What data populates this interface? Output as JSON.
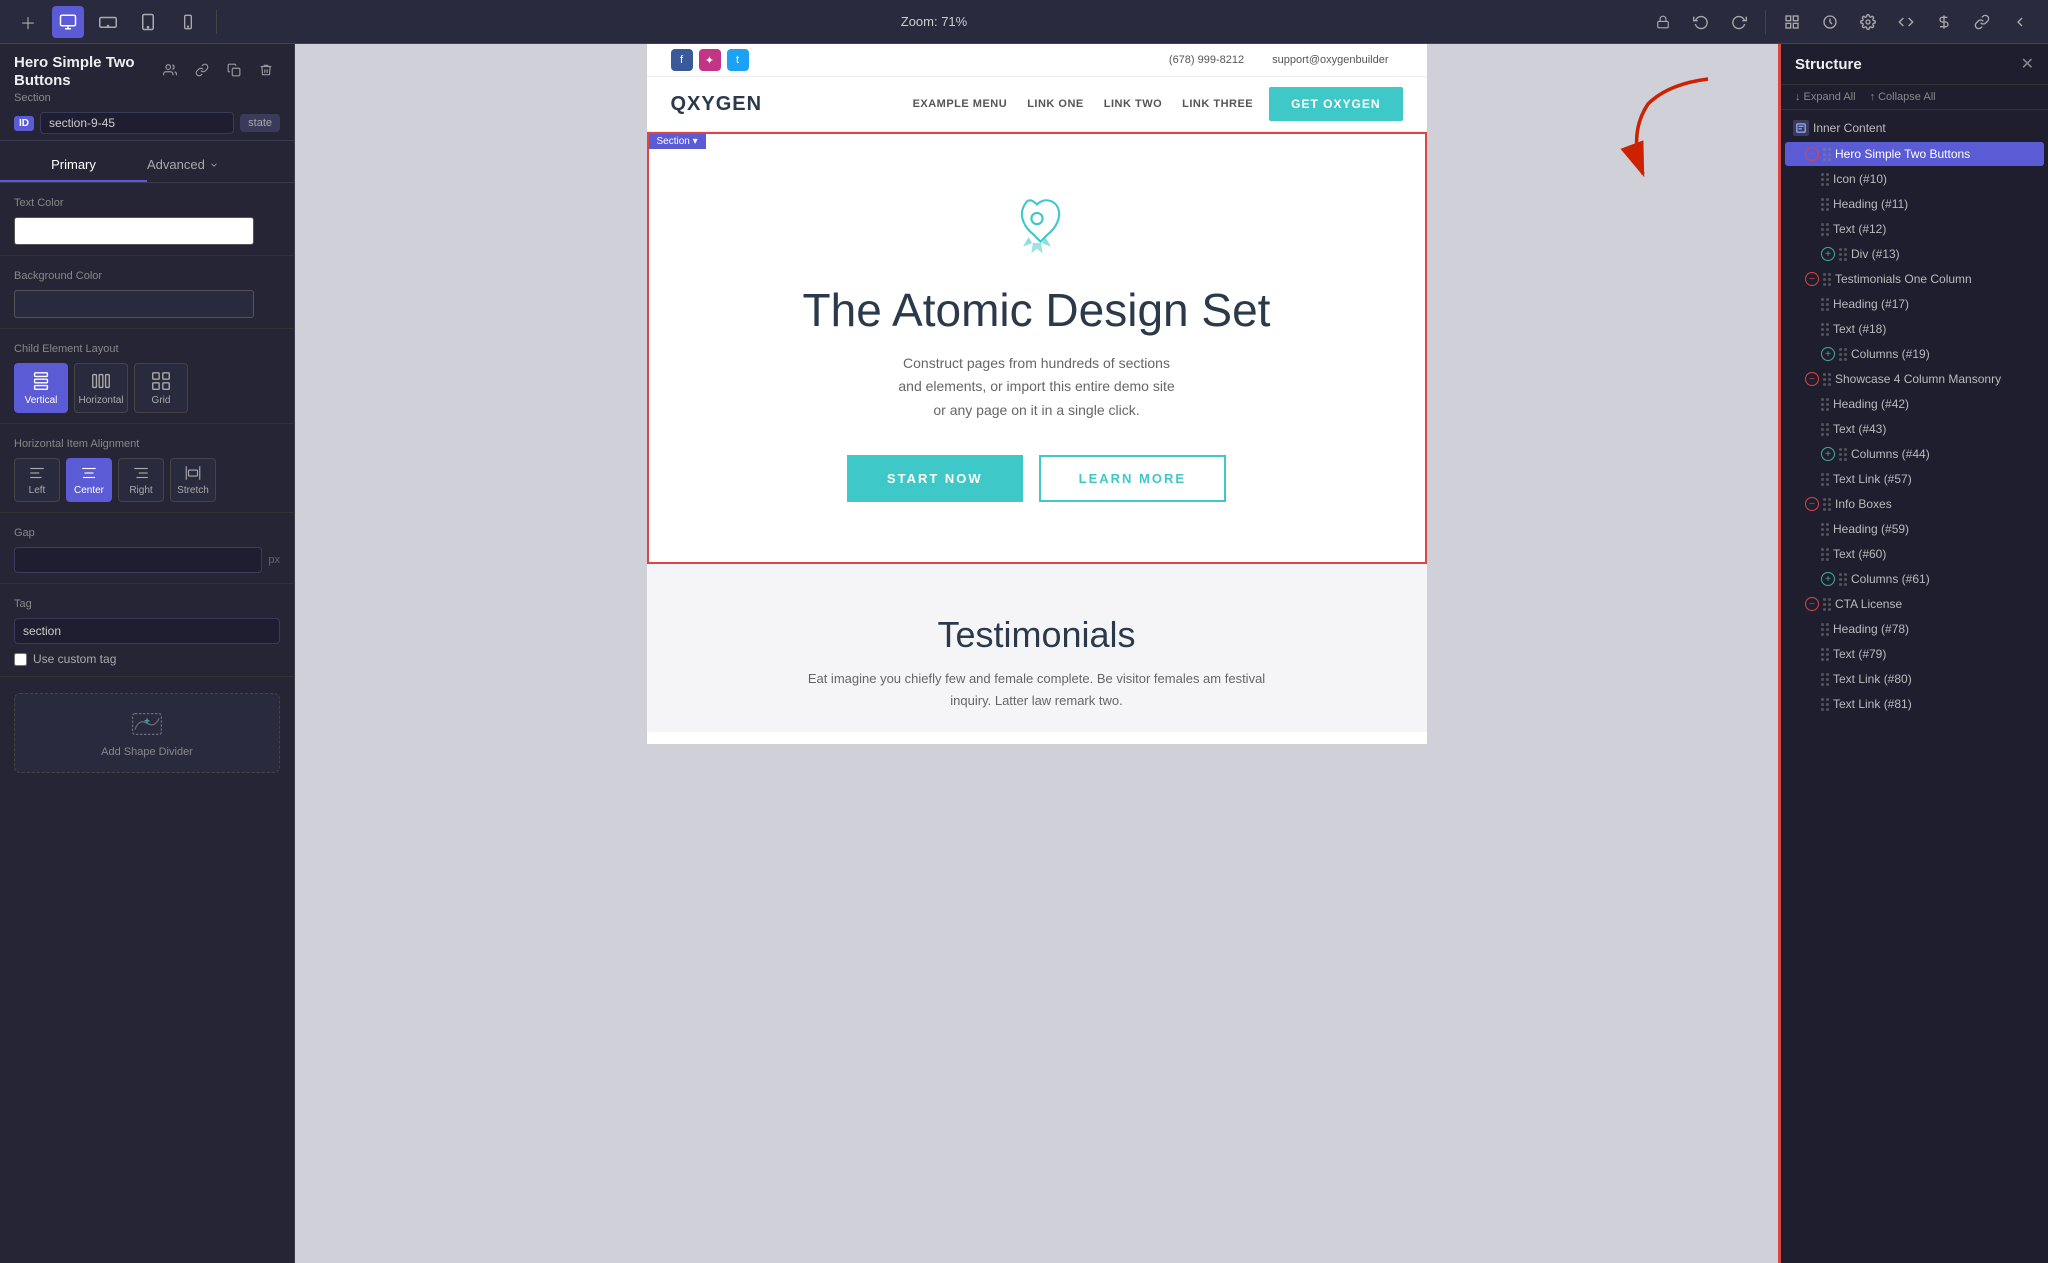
{
  "toolbar": {
    "zoom_label": "Zoom: 71%",
    "icons": [
      "plus",
      "desktop",
      "tablet_landscape",
      "tablet_portrait",
      "mobile"
    ],
    "right_icons": [
      "lock",
      "undo",
      "redo",
      "layout",
      "history",
      "settings",
      "code",
      "grid",
      "link",
      "more"
    ]
  },
  "left_panel": {
    "component_title": "Hero Simple Two Buttons",
    "component_subtitle": "Section",
    "id_label": "ID",
    "id_value": "section-9-45",
    "state_btn": "state",
    "tabs": [
      "Primary",
      "Advanced"
    ],
    "text_color_label": "Text Color",
    "bg_color_label": "Background Color",
    "child_layout_label": "Child Element Layout",
    "layout_options": [
      "Vertical",
      "Horizontal",
      "Grid"
    ],
    "align_label": "Horizontal Item Alignment",
    "align_options": [
      "Left",
      "Center",
      "Right",
      "Stretch"
    ],
    "gap_label": "Gap",
    "gap_placeholder": "",
    "gap_unit": "px",
    "tag_label": "Tag",
    "tag_value": "section",
    "custom_tag_label": "Use custom tag",
    "add_shape_label": "Add Shape Divider"
  },
  "canvas": {
    "topbar": {
      "phone": "(678) 999-8212",
      "email": "support@oxygenbuilder",
      "social": [
        "f",
        "i",
        "t"
      ]
    },
    "header": {
      "logo": "QXYGEN",
      "nav": [
        "EXAMPLE MENU",
        "LINK ONE",
        "LINK TWO",
        "LINK THREE"
      ],
      "cta": "GET OXYGEN"
    },
    "hero": {
      "title": "The Atomic Design Set",
      "description": "Construct pages from hundreds of sections\nand elements, or import this entire demo site\nor any page on it in a single click.",
      "btn_primary": "START NOW",
      "btn_secondary": "LEARN MORE",
      "section_label": "Section ▾"
    },
    "testimonials": {
      "title": "Testimonials",
      "text": "Eat imagine you chiefly few and female complete. Be visitor females am festival inquiry. Latter law remark two."
    }
  },
  "right_panel": {
    "title": "Structure",
    "expand": "↓ Expand All",
    "collapse": "↑ Collapse All",
    "items": [
      {
        "label": "Inner Content",
        "type": "inner-content",
        "indent": 0
      },
      {
        "label": "Hero Simple Two Buttons",
        "type": "section",
        "indent": 1,
        "selected": true,
        "toggle": "minus"
      },
      {
        "label": "Icon (#10)",
        "type": "element",
        "indent": 2
      },
      {
        "label": "Heading (#11)",
        "type": "element",
        "indent": 2
      },
      {
        "label": "Text (#12)",
        "type": "element",
        "indent": 2
      },
      {
        "label": "Div (#13)",
        "type": "element",
        "indent": 2,
        "toggle": "plus"
      },
      {
        "label": "Testimonials One Column",
        "type": "section",
        "indent": 1,
        "toggle": "minus"
      },
      {
        "label": "Heading (#17)",
        "type": "element",
        "indent": 2
      },
      {
        "label": "Text (#18)",
        "type": "element",
        "indent": 2
      },
      {
        "label": "Columns (#19)",
        "type": "element",
        "indent": 2,
        "toggle": "plus"
      },
      {
        "label": "Showcase 4 Column Mansonry",
        "type": "section",
        "indent": 1,
        "toggle": "minus"
      },
      {
        "label": "Heading (#42)",
        "type": "element",
        "indent": 2
      },
      {
        "label": "Text (#43)",
        "type": "element",
        "indent": 2
      },
      {
        "label": "Columns (#44)",
        "type": "element",
        "indent": 2,
        "toggle": "plus"
      },
      {
        "label": "Text Link (#57)",
        "type": "element",
        "indent": 2
      },
      {
        "label": "Info Boxes",
        "type": "section",
        "indent": 1,
        "toggle": "minus"
      },
      {
        "label": "Heading (#59)",
        "type": "element",
        "indent": 2
      },
      {
        "label": "Text (#60)",
        "type": "element",
        "indent": 2
      },
      {
        "label": "Columns (#61)",
        "type": "element",
        "indent": 2,
        "toggle": "plus"
      },
      {
        "label": "CTA License",
        "type": "section",
        "indent": 1,
        "toggle": "minus"
      },
      {
        "label": "Heading (#78)",
        "type": "element",
        "indent": 2
      },
      {
        "label": "Text (#79)",
        "type": "element",
        "indent": 2
      },
      {
        "label": "Text Link (#80)",
        "type": "element",
        "indent": 2
      },
      {
        "label": "Text Link (#81)",
        "type": "element",
        "indent": 2
      }
    ]
  }
}
